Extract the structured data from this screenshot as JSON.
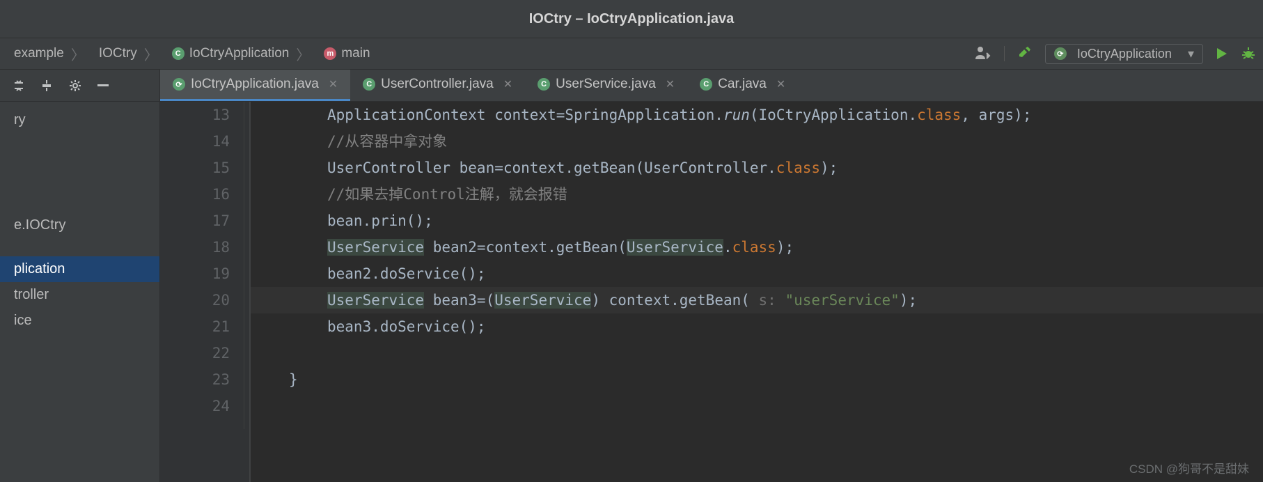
{
  "window_title": "IOCtry – IoCtryApplication.java",
  "breadcrumbs": {
    "b0": "example",
    "b1": "IOCtry",
    "b2": "IoCtryApplication",
    "b3": "main"
  },
  "run_config": {
    "label": "IoCtryApplication"
  },
  "tabs": {
    "t0": "IoCtryApplication.java",
    "t1": "UserController.java",
    "t2": "UserService.java",
    "t3": "Car.java"
  },
  "sidebar": {
    "i0": "ry",
    "i1": "e.IOCtry",
    "i2": "plication",
    "i3": "troller",
    "i4": "ice"
  },
  "gutter": {
    "l0": "13",
    "l1": "14",
    "l2": "15",
    "l3": "16",
    "l4": "17",
    "l5": "18",
    "l6": "19",
    "l7": "20",
    "l8": "21",
    "l9": "22",
    "l10": "23",
    "l11": "24"
  },
  "code": {
    "l0_a": "ApplicationContext context=SpringApplication.",
    "l0_b": "run",
    "l0_c": "(IoCtryApplication.",
    "l0_d": "class",
    "l0_e": ", args);",
    "l1": "//从容器中拿对象",
    "l2_a": "UserController bean=context.getBean(UserController.",
    "l2_b": "class",
    "l2_c": ");",
    "l3": "//如果去掉Control注解，就会报错",
    "l4": "bean.prin();",
    "l5_a": "UserService",
    "l5_b": " bean2=context.getBean(",
    "l5_c": "UserService",
    "l5_d": ".",
    "l5_e": "class",
    "l5_f": ");",
    "l6": "bean2.doService();",
    "l7_a": "UserService",
    "l7_b": " bean3=(",
    "l7_c": "UserService",
    "l7_d": ") context.getBean( ",
    "l7_p": "s: ",
    "l7_s": "\"userService\"",
    "l7_e": ");",
    "l8": "bean3.doService();",
    "l10": "}"
  },
  "watermark": "CSDN @狗哥不是甜妹"
}
